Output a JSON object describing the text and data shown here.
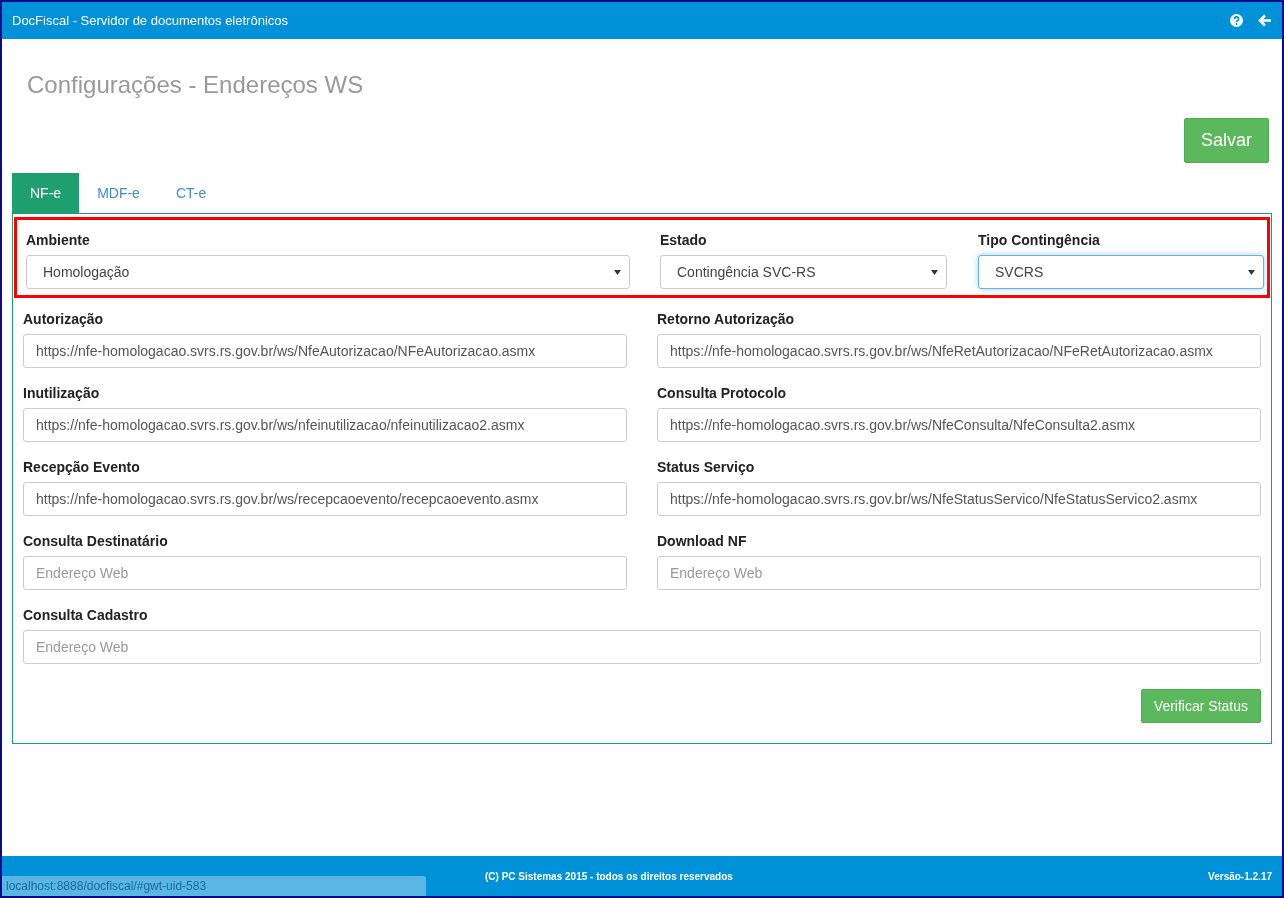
{
  "window": {
    "title": "DocFiscal - Servidor de documentos eletrônicos"
  },
  "page_title": "Configurações - Endereços WS",
  "save_button": "Salvar",
  "tabs": [
    {
      "label": "NF-e",
      "selected": true
    },
    {
      "label": "MDF-e",
      "selected": false
    },
    {
      "label": "CT-e",
      "selected": false
    }
  ],
  "selects": [
    {
      "label": "Ambiente",
      "value": "Homologação",
      "focused": false
    },
    {
      "label": "Estado",
      "value": "Contingência SVC-RS",
      "focused": false
    },
    {
      "label": "Tipo Contingência",
      "value": "SVCRS",
      "focused": true
    }
  ],
  "fields": [
    {
      "label": "Autorização",
      "value": "https://nfe-homologacao.svrs.rs.gov.br/ws/NfeAutorizacao/NFeAutorizacao.asmx",
      "kind": "half"
    },
    {
      "label": "Retorno Autorização",
      "value": "https://nfe-homologacao.svrs.rs.gov.br/ws/NfeRetAutorizacao/NFeRetAutorizacao.asmx",
      "kind": "half"
    },
    {
      "label": "Inutilização",
      "value": "https://nfe-homologacao.svrs.rs.gov.br/ws/nfeinutilizacao/nfeinutilizacao2.asmx",
      "kind": "half"
    },
    {
      "label": "Consulta Protocolo",
      "value": "https://nfe-homologacao.svrs.rs.gov.br/ws/NfeConsulta/NfeConsulta2.asmx",
      "kind": "half"
    },
    {
      "label": "Recepção Evento",
      "value": "https://nfe-homologacao.svrs.rs.gov.br/ws/recepcaoevento/recepcaoevento.asmx",
      "kind": "half"
    },
    {
      "label": "Status Serviço",
      "value": "https://nfe-homologacao.svrs.rs.gov.br/ws/NfeStatusServico/NfeStatusServico2.asmx",
      "kind": "half"
    },
    {
      "label": "Consulta Destinatário",
      "placeholder": "Endereço Web",
      "kind": "half"
    },
    {
      "label": "Download NF",
      "placeholder": "Endereço Web",
      "kind": "half"
    },
    {
      "label": "Consulta Cadastro",
      "placeholder": "Endereço Web",
      "kind": "full"
    }
  ],
  "check_button": "Verificar Status",
  "footer": {
    "copyright": "(C) PC Sistemas 2015 - todos os direitos reservados",
    "version": "Versão-1.2.17"
  },
  "status_url": "localhost:8888/docfiscal/#gwt-uid-583"
}
